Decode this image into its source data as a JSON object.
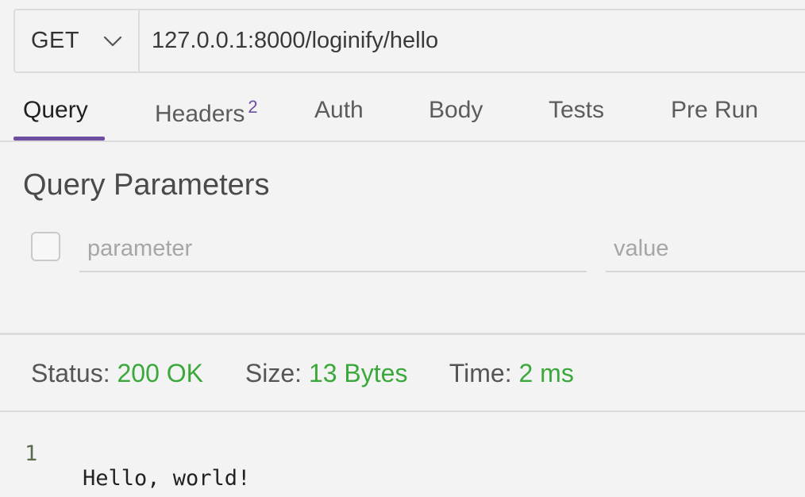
{
  "request": {
    "method": "GET",
    "url": "127.0.0.1:8000/loginify/hello"
  },
  "tabs": [
    {
      "label": "Query",
      "active": true
    },
    {
      "label": "Headers",
      "badge": "2"
    },
    {
      "label": "Auth"
    },
    {
      "label": "Body"
    },
    {
      "label": "Tests"
    },
    {
      "label": "Pre Run"
    }
  ],
  "query": {
    "title": "Query Parameters",
    "param_placeholder": "parameter",
    "value_placeholder": "value"
  },
  "response": {
    "status_label": "Status:",
    "status_value": "200 OK",
    "size_label": "Size:",
    "size_value": "13 Bytes",
    "time_label": "Time:",
    "time_value": "2 ms",
    "lines": [
      {
        "number": "1",
        "text": "Hello, world!"
      }
    ]
  },
  "colors": {
    "accent": "#6d4ea3",
    "success": "#3aa83a"
  }
}
